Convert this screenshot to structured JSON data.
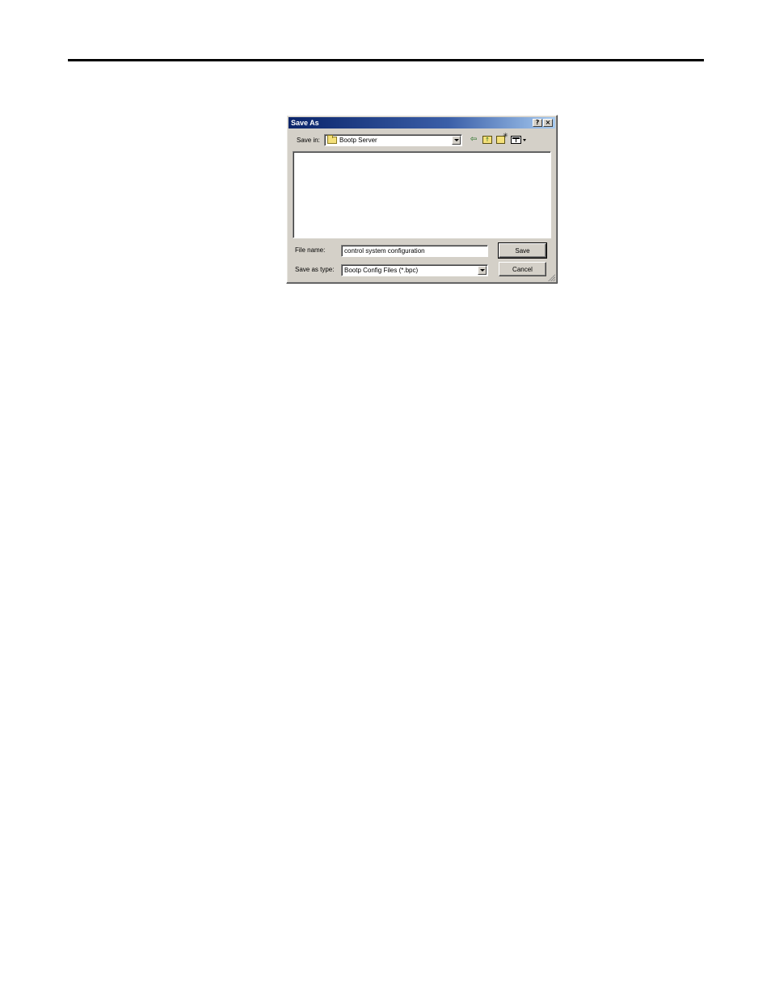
{
  "dialog": {
    "title": "Save As",
    "help_button": "?",
    "close_button": "×"
  },
  "save_in": {
    "label": "Save in:",
    "value": "Bootp Server"
  },
  "toolbar": {
    "back_icon": "back-arrow-icon",
    "up_icon": "up-one-level-icon",
    "new_folder_icon": "new-folder-icon",
    "views_icon": "views-menu-icon"
  },
  "file_name": {
    "label": "File name:",
    "value": "control system configuration"
  },
  "save_as_type": {
    "label": "Save as type:",
    "value": "Bootp Config Files (*.bpc)"
  },
  "buttons": {
    "save": "Save",
    "cancel": "Cancel"
  },
  "colors": {
    "titlebar": "#0a246a",
    "face": "#d4d0c8"
  }
}
